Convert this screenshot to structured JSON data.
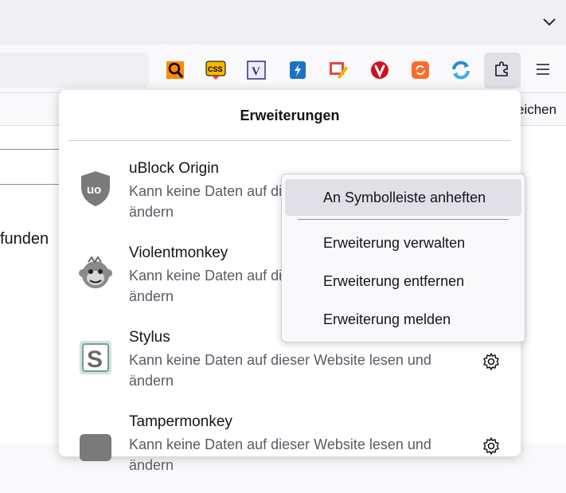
{
  "panel": {
    "title": "Erweiterungen"
  },
  "bookmarks": {
    "partial_label": "eichen"
  },
  "page": {
    "partial_text": "funden"
  },
  "toolbar": {
    "extension_icons": [
      {
        "name": "search-extension-icon",
        "color": "#ff8a00"
      },
      {
        "name": "css-extension-icon",
        "color": "#e8a400"
      },
      {
        "name": "v-extension-icon",
        "color": "#2e2e8c"
      },
      {
        "name": "bolt-extension-icon",
        "color": "#1a73c9"
      },
      {
        "name": "picture-edit-extension-icon",
        "color": "#e04848"
      },
      {
        "name": "vivaldi-extension-icon",
        "color": "#d0101d"
      },
      {
        "name": "sync-extension-icon",
        "color": "#ff6a2b"
      },
      {
        "name": "refresh-extension-icon",
        "color": "#2a8ad4"
      }
    ]
  },
  "extensions": [
    {
      "name": "uBlock Origin",
      "description": "Kann keine Daten auf dieser Website lesen und ändern",
      "icon": "ublock-shield-icon"
    },
    {
      "name": "Violentmonkey",
      "description": "Kann keine Daten auf dieser Website lesen und ändern",
      "icon": "monkey-icon"
    },
    {
      "name": "Stylus",
      "description": "Kann keine Daten auf dieser Website lesen und ändern",
      "icon": "stylus-s-icon"
    },
    {
      "name": "Tampermonkey",
      "description": "Kann keine Daten auf dieser Website lesen und ändern",
      "icon": "tampermonkey-icon"
    }
  ],
  "context_menu": {
    "items": [
      {
        "label": "An Symbolleiste anheften",
        "highlighted": true
      },
      {
        "label": "Erweiterung verwalten"
      },
      {
        "label": "Erweiterung entfernen"
      },
      {
        "label": "Erweiterung melden"
      }
    ]
  }
}
